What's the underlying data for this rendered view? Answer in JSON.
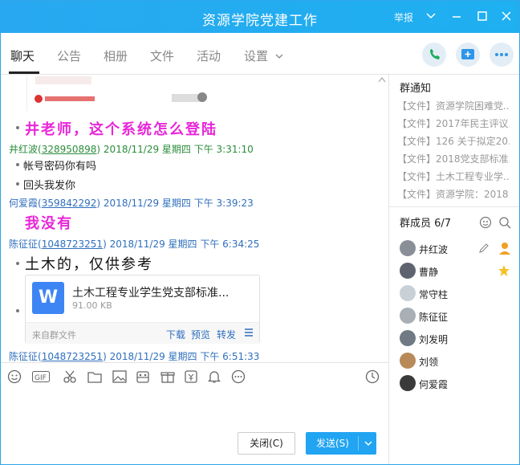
{
  "window": {
    "title": "资源学院党建工作",
    "report_label": "举报"
  },
  "tabs": [
    {
      "label": "聊天"
    },
    {
      "label": "公告"
    },
    {
      "label": "相册"
    },
    {
      "label": "文件"
    },
    {
      "label": "活动"
    },
    {
      "label": "设置"
    }
  ],
  "chat": {
    "messages": [
      {
        "text": "井老师，这个系统怎么登陆"
      },
      {
        "name": "井红波",
        "qq": "328950898",
        "time": "2018/11/29 星期四 下午 3:31:10",
        "lines": [
          "帐号密码你有吗",
          "回头我发你"
        ]
      },
      {
        "name": "何爱霞",
        "qq": "359842292",
        "time": "2018/11/29 星期四 下午 3:39:23",
        "text": "我没有"
      },
      {
        "name": "陈征征",
        "qq": "1048723251",
        "time": "2018/11/29 星期四 下午 6:34:25",
        "text": "土木的，仅供参考"
      },
      {
        "name": "陈征征",
        "qq": "1048723251",
        "time": "2018/11/29 星期四 下午 6:51:33"
      }
    ],
    "file": {
      "name": "土木工程专业学生党支部标准...",
      "size": "91.00 KB",
      "source": "来自群文件",
      "download": "下载",
      "preview": "预览",
      "forward": "转发",
      "icon_letter": "W"
    }
  },
  "buttons": {
    "close": "关闭(C)",
    "send": "发送(S)"
  },
  "sidebar": {
    "notice_title": "群通知",
    "notices": [
      "【文件】资源学院困难党...",
      "【文件】2017年民主评议...",
      "【文件】126 关于拟定20...",
      "【文件】2018党支部标准...",
      "【文件】土木工程专业学...",
      "【文件】资源学院：2018..."
    ],
    "members_title": "群成员 6/7",
    "members": [
      "井红波",
      "曹静",
      "常守柱",
      "陈征征",
      "刘发明",
      "刘领",
      "何爱霞"
    ]
  }
}
